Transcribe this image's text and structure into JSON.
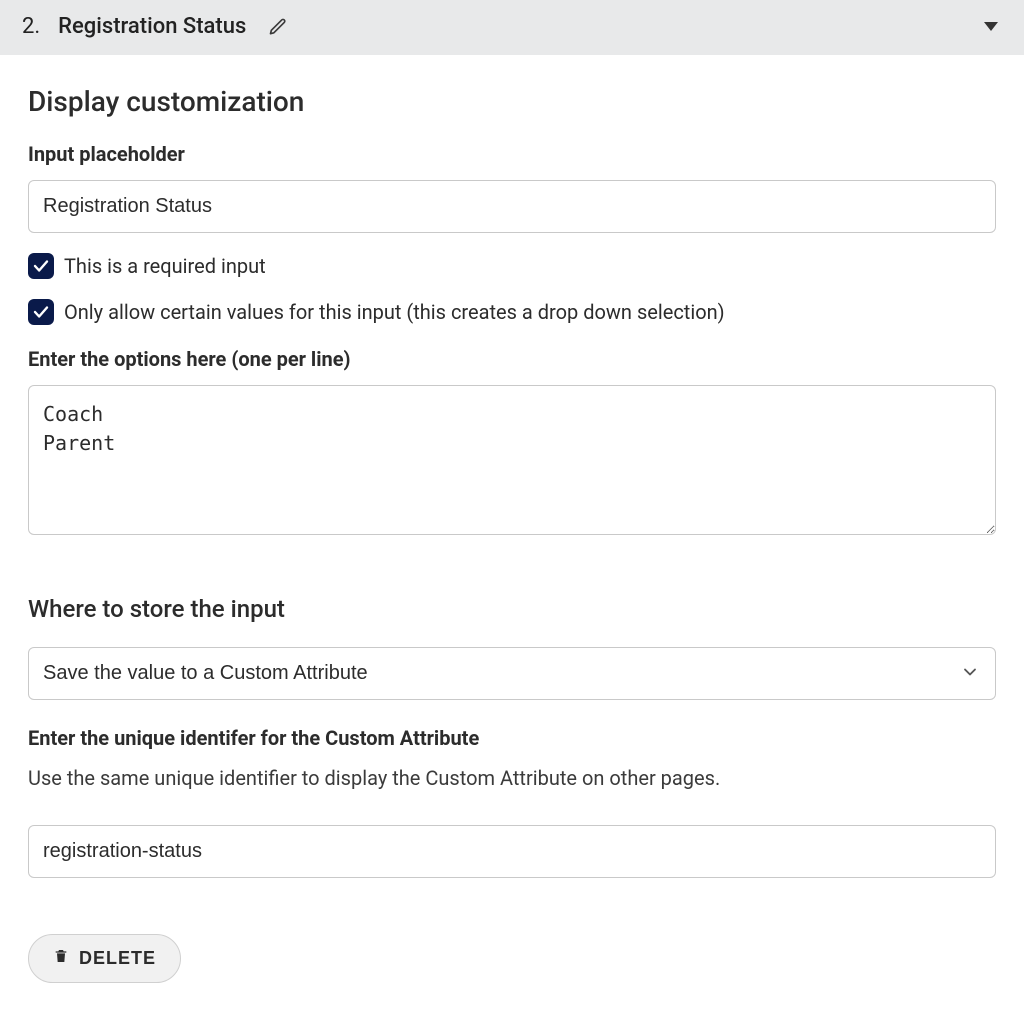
{
  "header": {
    "number": "2.",
    "title": "Registration Status"
  },
  "display": {
    "section_title": "Display customization",
    "placeholder_label": "Input placeholder",
    "placeholder_value": "Registration Status",
    "required_label": "This is a required input",
    "allow_values_label": "Only allow certain values for this input (this creates a drop down selection)",
    "options_label": "Enter the options here (one per line)",
    "options_value": "Coach\nParent"
  },
  "storage": {
    "section_title": "Where to store the input",
    "select_value": "Save the value to a Custom Attribute",
    "identifier_label": "Enter the unique identifer for the Custom Attribute",
    "identifier_help": "Use the same unique identifier to display the Custom Attribute on other pages.",
    "identifier_value": "registration-status"
  },
  "actions": {
    "delete_label": "DELETE"
  }
}
